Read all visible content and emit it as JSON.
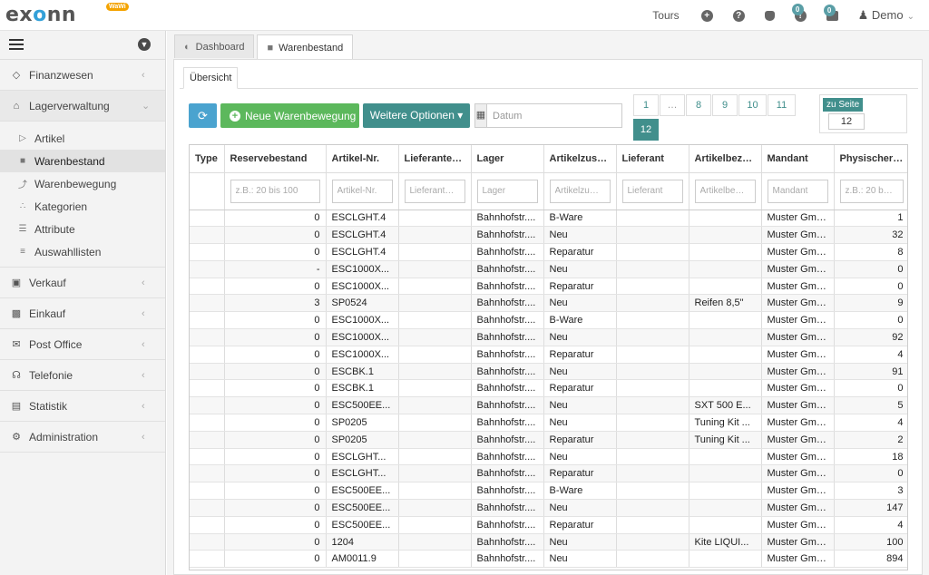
{
  "header": {
    "logo_text": "exonn",
    "logo_badge": "WaWi",
    "tours_label": "Tours",
    "notifications_count": "0",
    "messages_count": "0",
    "user_name": "Demo"
  },
  "sidebar": {
    "items": [
      {
        "label": "Finanzwesen",
        "icon": "diamond-icon"
      },
      {
        "label": "Lagerverwaltung",
        "icon": "warehouse-icon"
      }
    ],
    "lager_sub": [
      {
        "label": "Artikel",
        "icon": "tag-icon"
      },
      {
        "label": "Warenbestand",
        "icon": "cube-icon"
      },
      {
        "label": "Warenbewegung",
        "icon": "move-icon"
      },
      {
        "label": "Kategorien",
        "icon": "sitemap-icon"
      },
      {
        "label": "Attribute",
        "icon": "list-icon"
      },
      {
        "label": "Auswahllisten",
        "icon": "checklist-icon"
      }
    ],
    "items_after": [
      {
        "label": "Verkauf",
        "icon": "cart-icon"
      },
      {
        "label": "Einkauf",
        "icon": "truck-icon"
      },
      {
        "label": "Post Office",
        "icon": "envelope-icon"
      },
      {
        "label": "Telefonie",
        "icon": "headset-icon"
      },
      {
        "label": "Statistik",
        "icon": "bar-chart-icon"
      },
      {
        "label": "Administration",
        "icon": "cogs-icon"
      }
    ]
  },
  "tabs": [
    {
      "label": "Dashboard",
      "icon": "dashboard-icon"
    },
    {
      "label": "Warenbestand",
      "icon": "cube-icon"
    }
  ],
  "subtab": "Übersicht",
  "toolbar": {
    "new_label": "Neue Warenbewegung",
    "more_label": "Weitere Optionen",
    "date_placeholder": "Datum"
  },
  "pager": {
    "pages": [
      "1",
      "…",
      "8",
      "9",
      "10",
      "11",
      "12"
    ],
    "active": "12"
  },
  "goto": {
    "label": "zu Seite",
    "value": "12"
  },
  "table": {
    "columns": [
      "Type",
      "Reservebestand",
      "Artikel-Nr.",
      "Lieferante…",
      "Lager",
      "Artikelzust…",
      "Lieferant",
      "Artikelbez…",
      "Mandant",
      "Physischer…"
    ],
    "filters": [
      "",
      "z.B.: 20 bis 100",
      "Artikel-Nr.",
      "Lieferant…",
      "Lager",
      "Artikelzu…",
      "Lieferant",
      "Artikelbe…",
      "Mandant",
      "z.B.: 20 b…"
    ],
    "rows": [
      [
        "",
        "0",
        "ESCLGHT.4",
        "",
        "Bahnhofstr....",
        "B-Ware",
        "",
        "",
        "Muster GmbH",
        "1"
      ],
      [
        "",
        "0",
        "ESCLGHT.4",
        "",
        "Bahnhofstr....",
        "Neu",
        "",
        "",
        "Muster GmbH",
        "32"
      ],
      [
        "",
        "0",
        "ESCLGHT.4",
        "",
        "Bahnhofstr....",
        "Reparatur",
        "",
        "",
        "Muster GmbH",
        "8"
      ],
      [
        "",
        "-",
        "ESC1000X...",
        "",
        "Bahnhofstr....",
        "Neu",
        "",
        "",
        "Muster GmbH",
        "0"
      ],
      [
        "",
        "0",
        "ESC1000X...",
        "",
        "Bahnhofstr....",
        "Reparatur",
        "",
        "",
        "Muster GmbH",
        "0"
      ],
      [
        "",
        "3",
        "SP0524",
        "",
        "Bahnhofstr....",
        "Neu",
        "",
        "Reifen 8,5\"",
        "Muster GmbH",
        "9"
      ],
      [
        "",
        "0",
        "ESC1000X...",
        "",
        "Bahnhofstr....",
        "B-Ware",
        "",
        "",
        "Muster GmbH",
        "0"
      ],
      [
        "",
        "0",
        "ESC1000X...",
        "",
        "Bahnhofstr....",
        "Neu",
        "",
        "",
        "Muster GmbH",
        "92"
      ],
      [
        "",
        "0",
        "ESC1000X...",
        "",
        "Bahnhofstr....",
        "Reparatur",
        "",
        "",
        "Muster GmbH",
        "4"
      ],
      [
        "",
        "0",
        "ESCBK.1",
        "",
        "Bahnhofstr....",
        "Neu",
        "",
        "",
        "Muster GmbH",
        "91"
      ],
      [
        "",
        "0",
        "ESCBK.1",
        "",
        "Bahnhofstr....",
        "Reparatur",
        "",
        "",
        "Muster GmbH",
        "0"
      ],
      [
        "",
        "0",
        "ESC500EE...",
        "",
        "Bahnhofstr....",
        "Neu",
        "",
        "SXT 500 E...",
        "Muster GmbH",
        "5"
      ],
      [
        "",
        "0",
        "SP0205",
        "",
        "Bahnhofstr....",
        "Neu",
        "",
        "Tuning Kit ...",
        "Muster GmbH",
        "4"
      ],
      [
        "",
        "0",
        "SP0205",
        "",
        "Bahnhofstr....",
        "Reparatur",
        "",
        "Tuning Kit ...",
        "Muster GmbH",
        "2"
      ],
      [
        "",
        "0",
        "ESCLGHT...",
        "",
        "Bahnhofstr....",
        "Neu",
        "",
        "",
        "Muster GmbH",
        "18"
      ],
      [
        "",
        "0",
        "ESCLGHT...",
        "",
        "Bahnhofstr....",
        "Reparatur",
        "",
        "",
        "Muster GmbH",
        "0"
      ],
      [
        "",
        "0",
        "ESC500EE...",
        "",
        "Bahnhofstr....",
        "B-Ware",
        "",
        "",
        "Muster GmbH",
        "3"
      ],
      [
        "",
        "0",
        "ESC500EE...",
        "",
        "Bahnhofstr....",
        "Neu",
        "",
        "",
        "Muster GmbH",
        "147"
      ],
      [
        "",
        "0",
        "ESC500EE...",
        "",
        "Bahnhofstr....",
        "Reparatur",
        "",
        "",
        "Muster GmbH",
        "4"
      ],
      [
        "",
        "0",
        "1204",
        "",
        "Bahnhofstr....",
        "Neu",
        "",
        "Kite LIQUI...",
        "Muster GmbH",
        "100"
      ],
      [
        "",
        "0",
        "AM0011.9",
        "",
        "Bahnhofstr....",
        "Neu",
        "",
        "",
        "Muster GmbH",
        "894"
      ]
    ]
  }
}
